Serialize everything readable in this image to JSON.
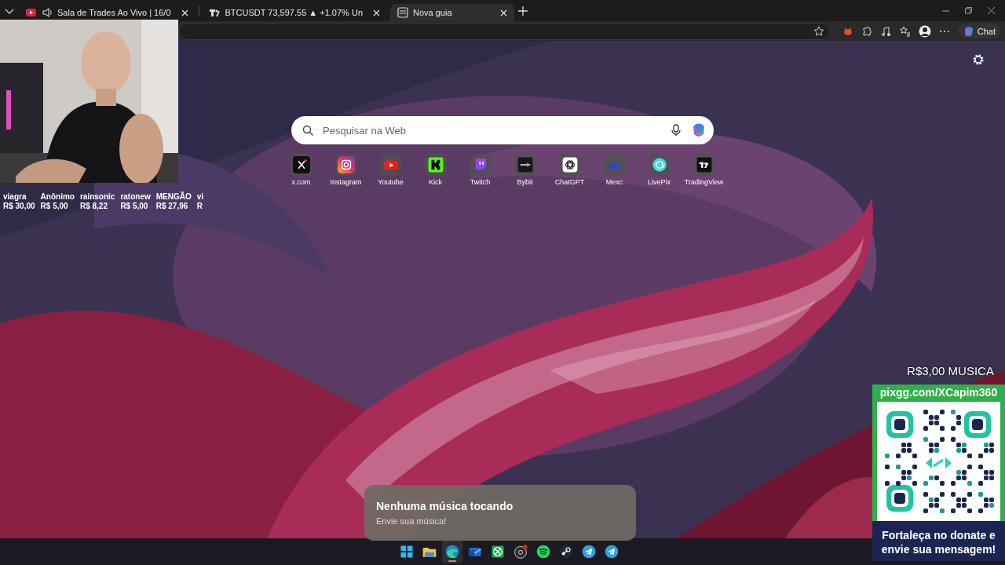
{
  "browser": {
    "tabs": [
      {
        "title": "Sala de Trades Ao Vivo | 16/0",
        "selected": false
      },
      {
        "title": "BTCUSDT 73,597.55 ▲ +1.07% Un",
        "selected": false
      },
      {
        "title": "Nova guia",
        "selected": true
      }
    ],
    "chat_button": "Chat"
  },
  "new_tab": {
    "search": {
      "placeholder": "Pesquisar na Web"
    },
    "shortcuts": [
      {
        "label": "x.com"
      },
      {
        "label": "Instagram"
      },
      {
        "label": "Youtube"
      },
      {
        "label": "Kick"
      },
      {
        "label": "Twitch"
      },
      {
        "label": "Bybit"
      },
      {
        "label": "ChatGPT"
      },
      {
        "label": "Mexc"
      },
      {
        "label": "LivePix"
      },
      {
        "label": "TradingView"
      }
    ]
  },
  "overlay": {
    "donors": [
      {
        "name": "viagra",
        "amount": "R$ 30,00"
      },
      {
        "name": "Anônimo",
        "amount": "R$ 5,00"
      },
      {
        "name": "rainsonic",
        "amount": "R$ 8,22"
      },
      {
        "name": "ratonew",
        "amount": "R$ 5,00"
      },
      {
        "name": "MENGÃO",
        "amount": "R$ 27,96"
      },
      {
        "name": "vi",
        "amount": "R"
      }
    ],
    "music_price": "R$3,00 MUSICA",
    "pix": {
      "url": "pixgg.com/XCapim360",
      "message": "Fortaleça no donate e envie sua mensagem!"
    },
    "now_playing": {
      "title": "Nenhuma música tocando",
      "subtitle": "Envie sua música!"
    }
  },
  "taskbar": {
    "apps": [
      {
        "selected": false
      },
      {
        "selected": false
      },
      {
        "selected": true
      },
      {
        "selected": false
      },
      {
        "selected": false
      },
      {
        "selected": false
      },
      {
        "selected": false
      },
      {
        "selected": false
      },
      {
        "selected": false
      },
      {
        "selected": false
      }
    ]
  }
}
